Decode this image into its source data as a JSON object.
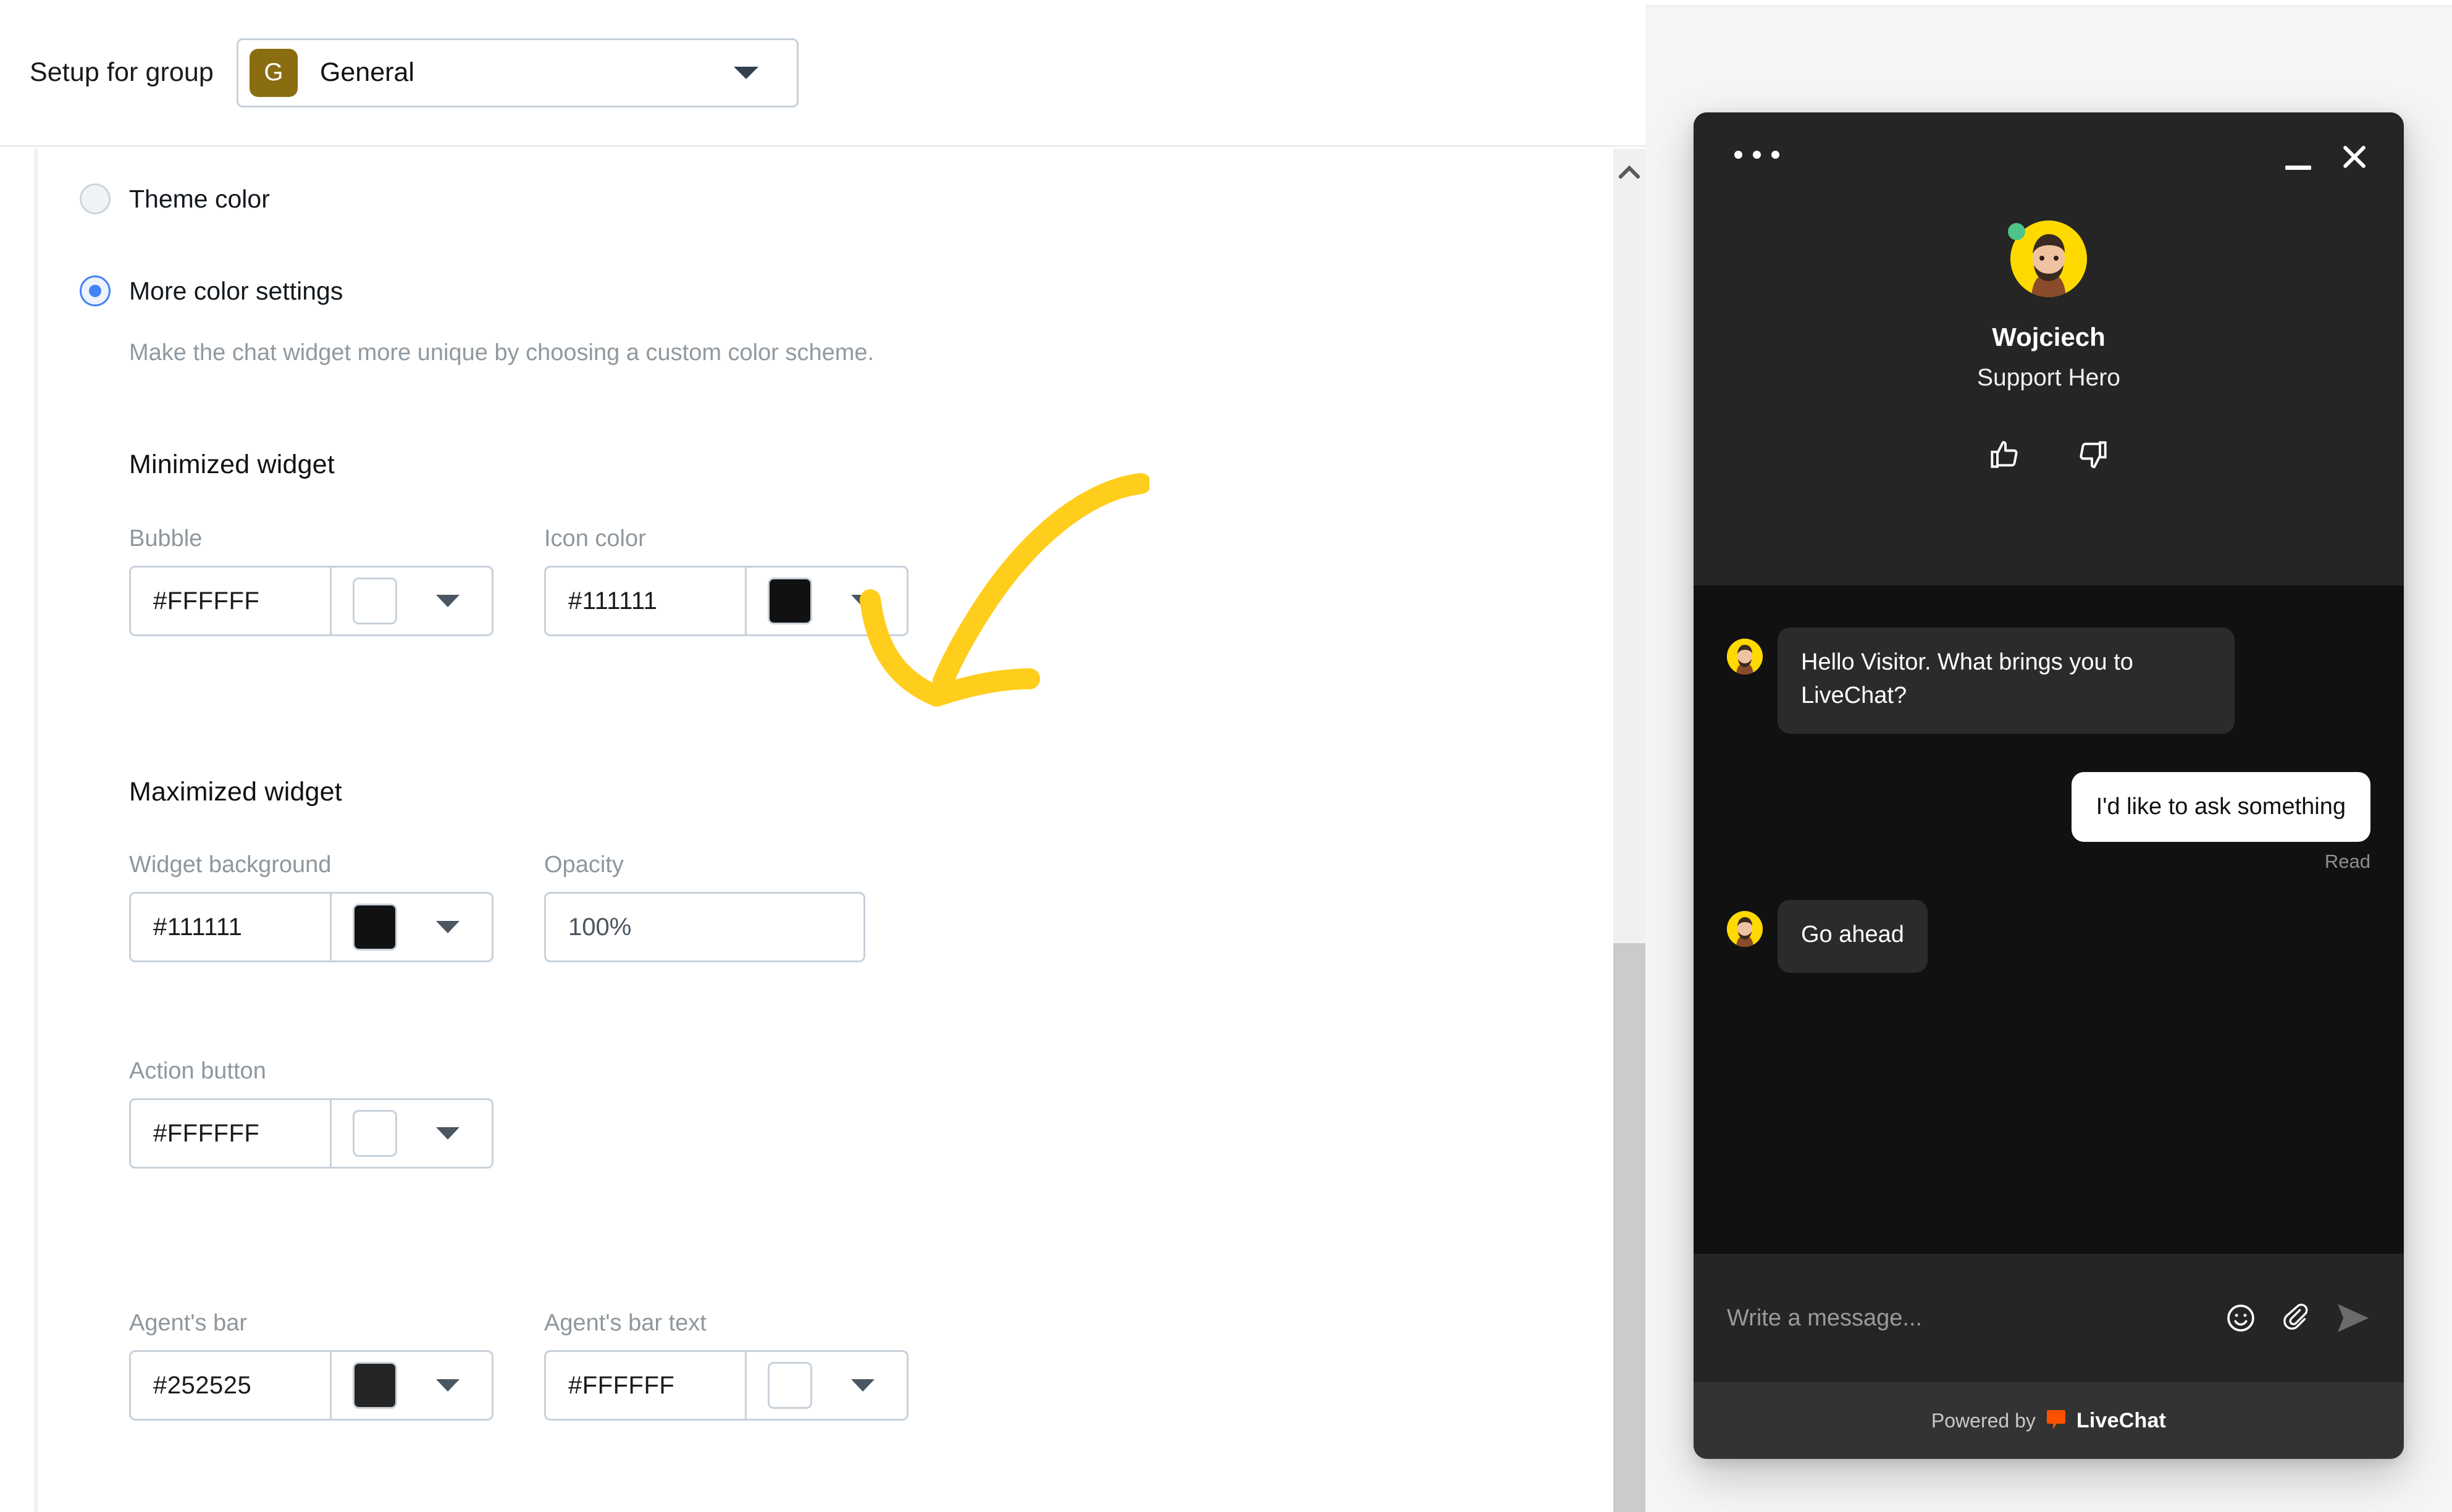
{
  "topbar": {
    "label": "Setup for group",
    "group_badge_letter": "G",
    "group_name": "General",
    "badge_color": "#8a6d10"
  },
  "options": {
    "theme_color_label": "Theme color",
    "more_color_label": "More color settings",
    "helper_text": "Make the chat widget more unique by choosing a custom color scheme.",
    "selected": "more_color_settings",
    "accent_color": "#4384f5"
  },
  "sections": {
    "minimized": {
      "title": "Minimized widget",
      "fields": [
        {
          "label": "Bubble",
          "value": "#FFFFFF",
          "swatch": "#FFFFFF"
        },
        {
          "label": "Icon color",
          "value": "#111111",
          "swatch": "#111111"
        }
      ]
    },
    "maximized": {
      "title": "Maximized widget",
      "fields": [
        {
          "label": "Widget background",
          "value": "#111111",
          "swatch": "#111111"
        },
        {
          "label": "Opacity",
          "value": "100%"
        },
        {
          "label": "Action button",
          "value": "#FFFFFF",
          "swatch": "#FFFFFF"
        },
        {
          "label": "Agent's bar",
          "value": "#252525",
          "swatch": "#252525"
        },
        {
          "label": "Agent's bar text",
          "value": "#FFFFFF",
          "swatch": "#FFFFFF"
        }
      ]
    }
  },
  "annotation": {
    "arrow_color": "#FFCD1C"
  },
  "widget": {
    "agent_name": "Wojciech",
    "agent_role": "Support Hero",
    "presence_color": "#4dc48a",
    "avatar_bg": "#ffd900",
    "header_bg": "#252525",
    "body_bg": "#111111",
    "messages": [
      {
        "from": "agent",
        "text": "Hello Visitor. What brings you to LiveChat?"
      },
      {
        "from": "visitor",
        "text": "I'd like to ask something",
        "status": "Read"
      },
      {
        "from": "agent",
        "text": "Go ahead"
      }
    ],
    "composer_placeholder": "Write a message...",
    "footer_prefix": "Powered by",
    "footer_brand": "LiveChat",
    "footer_brand_color": "#FF5100"
  }
}
